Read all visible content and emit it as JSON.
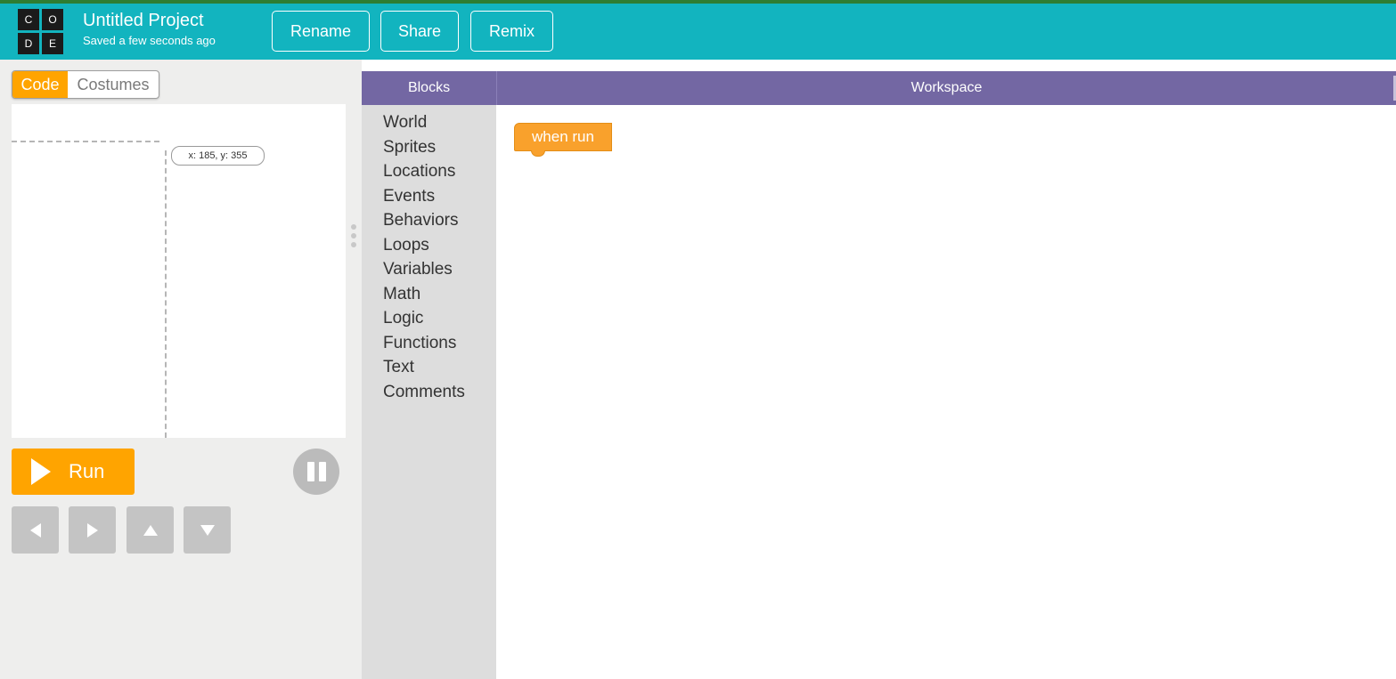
{
  "header": {
    "logo_letters": [
      "C",
      "O",
      "D",
      "E"
    ],
    "project_title": "Untitled Project",
    "save_status": "Saved a few seconds ago",
    "buttons": {
      "rename": "Rename",
      "share": "Share",
      "remix": "Remix"
    },
    "accent_color": "#12b4bf"
  },
  "left_panel": {
    "tabs": {
      "code": "Code",
      "costumes": "Costumes"
    },
    "coordinates": "x: 185, y: 355",
    "run_label": "Run"
  },
  "blocks": {
    "header": "Blocks",
    "categories": [
      "World",
      "Sprites",
      "Locations",
      "Events",
      "Behaviors",
      "Loops",
      "Variables",
      "Math",
      "Logic",
      "Functions",
      "Text",
      "Comments"
    ]
  },
  "workspace": {
    "header": "Workspace",
    "when_run_block": "when run"
  }
}
